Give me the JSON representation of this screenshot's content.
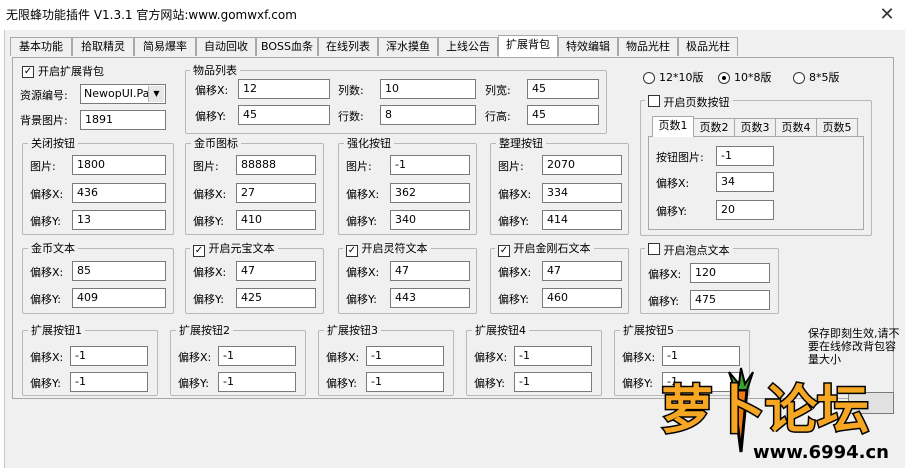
{
  "window": {
    "title": "无限蜂功能插件 V1.3.1  官方网站:www.gomwxf.com",
    "close_glyph": "✕"
  },
  "tabs": [
    "基本功能",
    "拾取精灵",
    "简易爆率",
    "自动回收",
    "BOSS血条",
    "在线列表",
    "浑水摸鱼",
    "上线公告",
    "扩展背包",
    "特效编辑",
    "物品光柱",
    "极品光柱"
  ],
  "ext_bag": {
    "enable_label": "开启扩展背包",
    "enabled": "✓",
    "resource_label": "资源编号:",
    "resource_value": "NewopUI.Pak",
    "bg_label": "背景图片:",
    "bg_value": "1891"
  },
  "item_list": {
    "title": "物品列表",
    "offset_x_label": "偏移X:",
    "offset_x": "12",
    "offset_y_label": "偏移Y:",
    "offset_y": "45",
    "cols_label": "列数:",
    "cols": "10",
    "rows_label": "行数:",
    "rows": "8",
    "col_w_label": "列宽:",
    "col_w": "45",
    "row_h_label": "行高:",
    "row_h": "45"
  },
  "layout_options": {
    "opt1": "12*10版",
    "opt2": "10*8版",
    "opt3": "8*5版",
    "selected": "opt2"
  },
  "page_btn": {
    "enable_label": "开启页数按钮",
    "subtabs": [
      "页数1",
      "页数2",
      "页数3",
      "页数4",
      "页数5"
    ],
    "img_label": "按钮图片:",
    "img": "-1",
    "x_label": "偏移X:",
    "x": "34",
    "y_label": "偏移Y:",
    "y": "20"
  },
  "close_btn": {
    "title": "关闭按钮",
    "img_label": "图片:",
    "img": "1800",
    "x_label": "偏移X:",
    "x": "436",
    "y_label": "偏移Y:",
    "y": "13"
  },
  "gold_icon": {
    "title": "金币图标",
    "img_label": "图片:",
    "img": "88888",
    "x_label": "偏移X:",
    "x": "27",
    "y_label": "偏移Y:",
    "y": "410"
  },
  "enhance_btn": {
    "title": "强化按钮",
    "img_label": "图片:",
    "img": "-1",
    "x_label": "偏移X:",
    "x": "362",
    "y_label": "偏移Y:",
    "y": "340"
  },
  "sort_btn": {
    "title": "整理按钮",
    "img_label": "图片:",
    "img": "2070",
    "x_label": "偏移X:",
    "x": "334",
    "y_label": "偏移Y:",
    "y": "414"
  },
  "gold_text": {
    "title": "金币文本",
    "x_label": "偏移X:",
    "x": "85",
    "y_label": "偏移Y:",
    "y": "409"
  },
  "yuanbao_text": {
    "title": "开启元宝文本",
    "check": "✓",
    "x_label": "偏移X:",
    "x": "47",
    "y_label": "偏移Y:",
    "y": "425"
  },
  "lingfu_text": {
    "title": "开启灵符文本",
    "check": "✓",
    "x_label": "偏移X:",
    "x": "47",
    "y_label": "偏移Y:",
    "y": "443"
  },
  "diamond_text": {
    "title": "开启金刚石文本",
    "check": "✓",
    "x_label": "偏移X:",
    "x": "47",
    "y_label": "偏移Y:",
    "y": "460"
  },
  "bubble_text": {
    "title": "开启泡点文本",
    "x_label": "偏移X:",
    "x": "120",
    "y_label": "偏移Y:",
    "y": "475"
  },
  "ext_buttons": [
    {
      "title": "扩展按钮1",
      "x_label": "偏移X:",
      "x": "-1",
      "y_label": "偏移Y:",
      "y": "-1"
    },
    {
      "title": "扩展按钮2",
      "x_label": "偏移X:",
      "x": "-1",
      "y_label": "偏移Y:",
      "y": "-1"
    },
    {
      "title": "扩展按钮3",
      "x_label": "偏移X:",
      "x": "-1",
      "y_label": "偏移Y:",
      "y": "-1"
    },
    {
      "title": "扩展按钮4",
      "x_label": "偏移X:",
      "x": "-1",
      "y_label": "偏移Y:",
      "y": "-1"
    },
    {
      "title": "扩展按钮5",
      "x_label": "偏移X:",
      "x": "-1",
      "y_label": "偏移Y:",
      "y": "-1"
    }
  ],
  "note": "保存即刻生效,请不要在线修改背包容量大小",
  "watermark": {
    "brand": "萝卜论坛",
    "url": "www.6994.cn"
  },
  "colors": {
    "accent": "#f0a020",
    "panel": "#f0f0f0",
    "border": "#a8a8a8"
  }
}
